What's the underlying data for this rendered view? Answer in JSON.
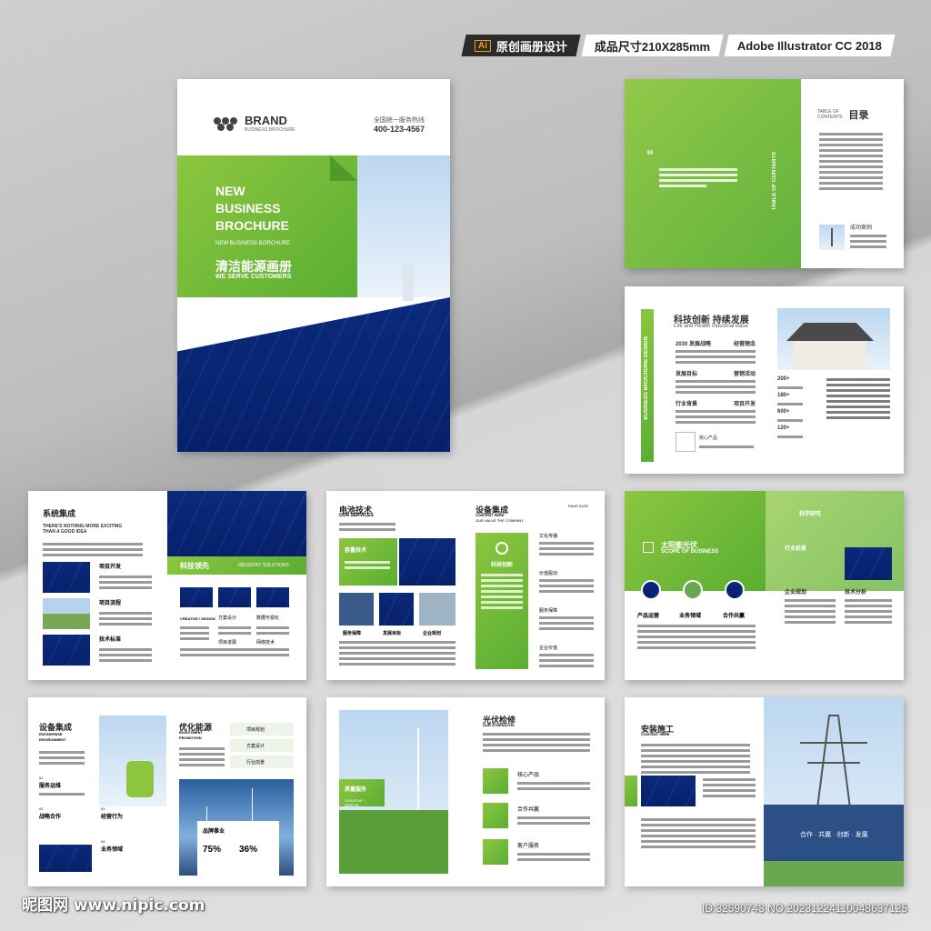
{
  "header": {
    "ai_icon": "Ai",
    "tag_original": "原创画册设计",
    "tag_size": "成品尺寸210X285mm",
    "tag_software": "Adobe Illustrator CC 2018"
  },
  "cover": {
    "brand": "BRAND",
    "brand_sub": "BUSINESS BROCHURE",
    "hotline_label": "全国统一服务热线",
    "hotline": "400-123-4567",
    "title_line1": "NEW",
    "title_line2": "BUSINESS",
    "title_line3": "BROCHURE",
    "subtitle_en": "NEW BUSINESS BORCHURE",
    "title_cn": "清洁能源画册",
    "slogan": "WE SERVE CUSTOMERS"
  },
  "toc": {
    "label_en": "TABLE OF CONTENTS",
    "label_cn": "目录",
    "vertical": "TABLE OF CONTENTS",
    "item_caption": "成功案例"
  },
  "spread2": {
    "title": "科技创新 持续发展",
    "subtitle": "Life and Health Industrial Base",
    "vertical": "BUSINESS BROCHURE DESIGN",
    "r1a": "2030 发展战略",
    "r1b": "经营理念",
    "r2a": "发展目标",
    "r2b": "营销活动",
    "r3a": "行业背景",
    "r3b": "项目开发",
    "c1": "核心产品",
    "stats": [
      "200+",
      "180+",
      "600+",
      "120+"
    ]
  },
  "spread3": {
    "title": "系统集成",
    "sub": "THERE'S NOTHING MORE EXCITING THAN A GOOD IDEA",
    "items": [
      "项目开发",
      "项目流程",
      "技术标准"
    ],
    "banner": "科技领先",
    "banner_en": "INDUSTRY SOLUTIONS",
    "creative": "CREATIVE / DESIGN",
    "cols": [
      "方案设计",
      "数据可视化",
      "项目进展",
      "网络技术"
    ]
  },
  "spread4": {
    "left_title": "电池技术",
    "left_sub": "OUR SERVICES",
    "box": "容量技术",
    "caps": [
      "服务保障",
      "发展目标",
      "企业规划"
    ],
    "right_title": "设备集成",
    "right_sub": "CONTENT HERE",
    "right_sub2": "OUR VALUE THE COMPANY",
    "page": "PAGE 01/02",
    "center": "科研创新",
    "items": [
      "文化传播",
      "价值驱动",
      "服务保障",
      "企业价值"
    ]
  },
  "spread5": {
    "title": "太阳能光伏",
    "title_en": "SCOPE OF BUSINESS",
    "icons": [
      "产品运营",
      "业务领域",
      "合作共赢"
    ],
    "right_title": "科学研究",
    "items": [
      "行业前景",
      "企业规划",
      "技术分析"
    ]
  },
  "spread6": {
    "title": "设备集成",
    "sub1": "ENTERPRISE",
    "sub2": "ENVIRONMENT",
    "items": [
      "服务运维",
      "战略合作",
      "经营行为",
      "业务领域"
    ],
    "nums": [
      "01",
      "02",
      "03",
      "04"
    ],
    "right_title": "优化能源",
    "right_sub1": "INVESTMENT",
    "right_sub2": "PROMOTION",
    "list": [
      "项目规划",
      "方案设计",
      "行业前景"
    ],
    "card": "品牌事业",
    "pct1": "75%",
    "pct2": "36%"
  },
  "spread7": {
    "badge": "质量服务",
    "badge_sub": "CREATIVE / DESIGN",
    "title": "光伏检修",
    "sub": "OUR STRENGTHS",
    "items": [
      "核心产品",
      "合作共赢",
      "客户服务"
    ]
  },
  "spread8": {
    "title": "安装施工",
    "sub": "CONTENT HERE",
    "caption": "合作 · 共赢 · 创新 · 发展"
  },
  "footer": {
    "site": "昵图网 www.nipic.com",
    "id": "ID:32590743 NO:20231224110048637125"
  }
}
